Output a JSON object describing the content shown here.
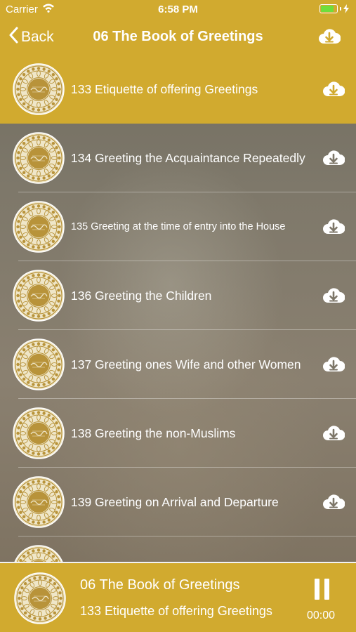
{
  "status_bar": {
    "carrier": "Carrier",
    "time": "6:58 PM"
  },
  "nav": {
    "back_label": "Back",
    "title": "06 The Book of Greetings",
    "download_icon": "cloud-download-icon"
  },
  "list": {
    "items": [
      {
        "label": "133 Etiquette of offering Greetings",
        "selected": true
      },
      {
        "label": "134 Greeting the Acquaintance Repeatedly"
      },
      {
        "label": "135 Greeting at the time of entry into the House"
      },
      {
        "label": "136 Greeting the Children"
      },
      {
        "label": "137 Greeting ones Wife and other Women"
      },
      {
        "label": "138 Greeting the non-Muslims"
      },
      {
        "label": "139 Greeting on Arrival and Departure"
      }
    ]
  },
  "player": {
    "title": "06 The Book of Greetings",
    "subtitle": "133 Etiquette of offering Greetings",
    "time": "00:00",
    "state_icon": "pause-icon"
  },
  "colors": {
    "accent": "#d1aa2f",
    "medallion_gold": "#b8933a",
    "medallion_light": "#efe6c8",
    "battery": "#6fde3b"
  }
}
